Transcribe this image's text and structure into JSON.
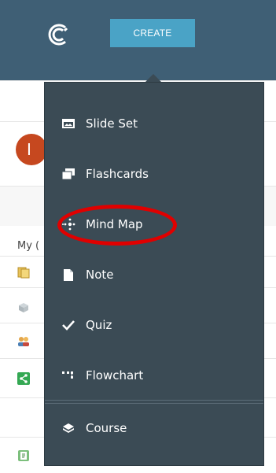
{
  "header": {
    "create_label": "CREATE"
  },
  "background": {
    "avatar_initial": "I",
    "list_label_partial": "My (",
    "list_icons": [
      "folder-icon",
      "box-icon",
      "people-icon",
      "share-icon",
      "document-icon"
    ]
  },
  "menu": {
    "items": [
      {
        "label": "Slide Set",
        "icon": "slide-set-icon"
      },
      {
        "label": "Flashcards",
        "icon": "flashcards-icon"
      },
      {
        "label": "Mind Map",
        "icon": "mind-map-icon"
      },
      {
        "label": "Note",
        "icon": "note-icon"
      },
      {
        "label": "Quiz",
        "icon": "check-icon"
      },
      {
        "label": "Flowchart",
        "icon": "flowchart-icon"
      },
      {
        "label": "Course",
        "icon": "course-icon"
      }
    ]
  },
  "colors": {
    "header_bg": "#3f5f75",
    "create_bg": "#4aa3c6",
    "menu_bg": "#3b4b55",
    "highlight": "#e00000",
    "avatar_bg": "#c6481f"
  }
}
